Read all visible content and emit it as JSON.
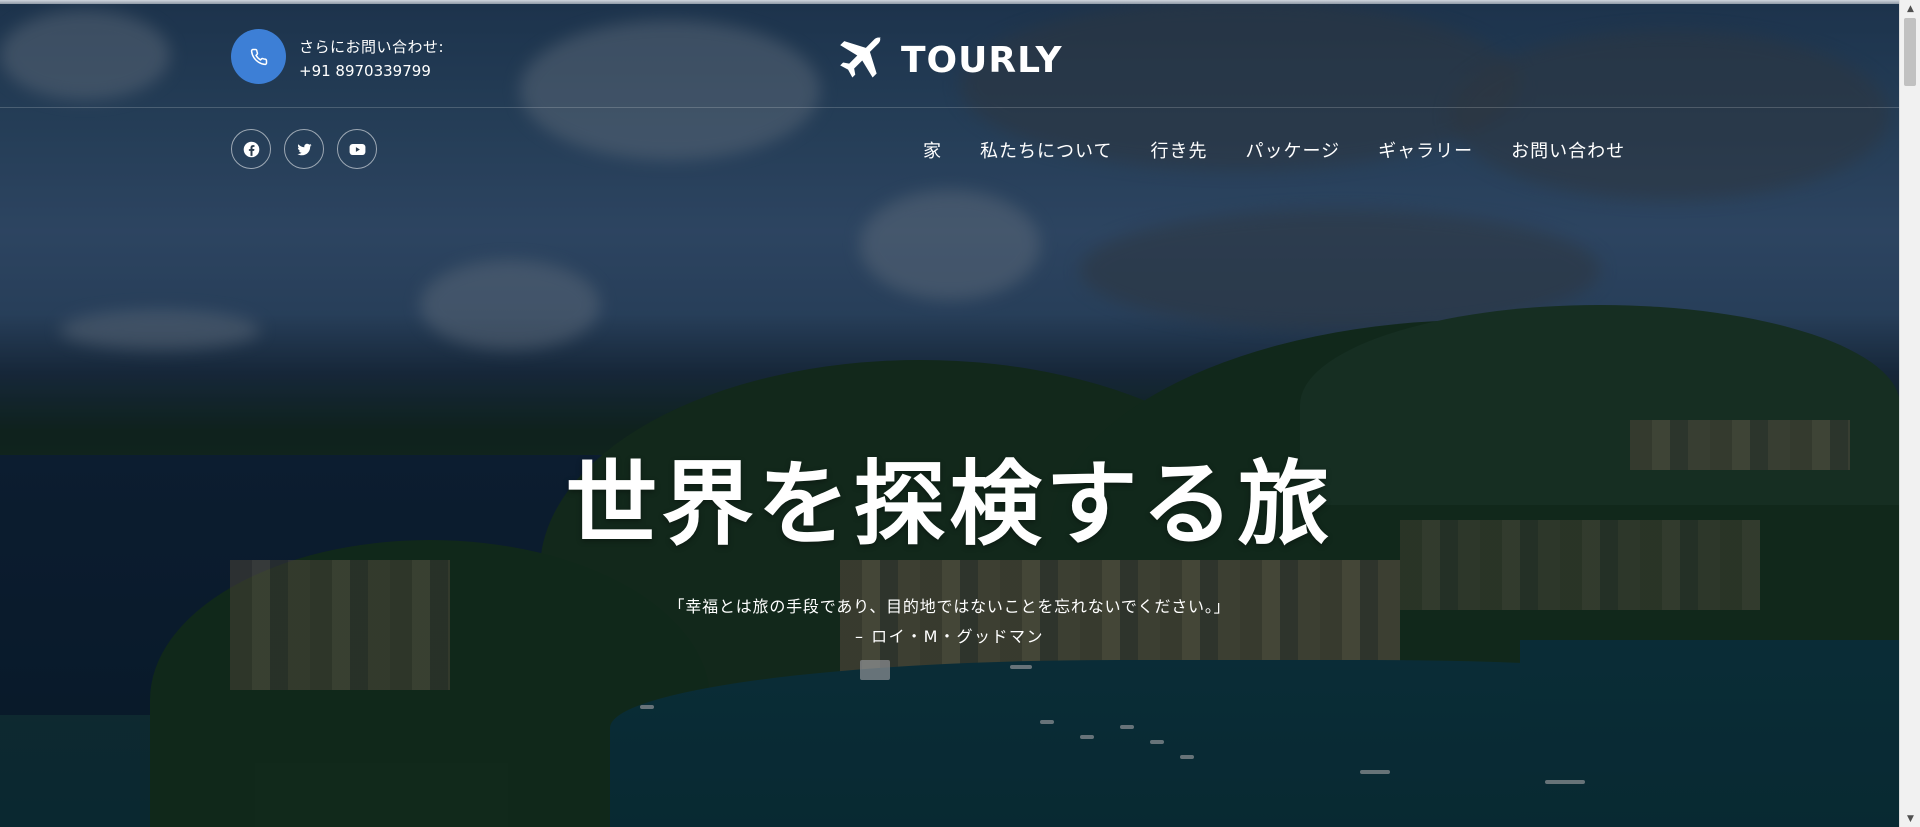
{
  "header": {
    "contact_label": "さらにお問い合わせ:",
    "contact_phone": "+91 8970339799",
    "brand": "TOURLY"
  },
  "social": [
    {
      "icon": "facebook-icon"
    },
    {
      "icon": "twitter-icon"
    },
    {
      "icon": "youtube-icon"
    }
  ],
  "nav": {
    "items": [
      {
        "label": "家"
      },
      {
        "label": "私たちについて"
      },
      {
        "label": "行き先"
      },
      {
        "label": "パッケージ"
      },
      {
        "label": "ギャラリー"
      },
      {
        "label": "お問い合わせ"
      }
    ]
  },
  "hero": {
    "title": "世界を探検する旅",
    "quote": "「幸福とは旅の手段であり、目的地ではないことを忘れないでください。」",
    "author": "– ロイ・M・グッドマン"
  },
  "colors": {
    "accent": "#3d7fd6",
    "text": "#ffffff"
  }
}
